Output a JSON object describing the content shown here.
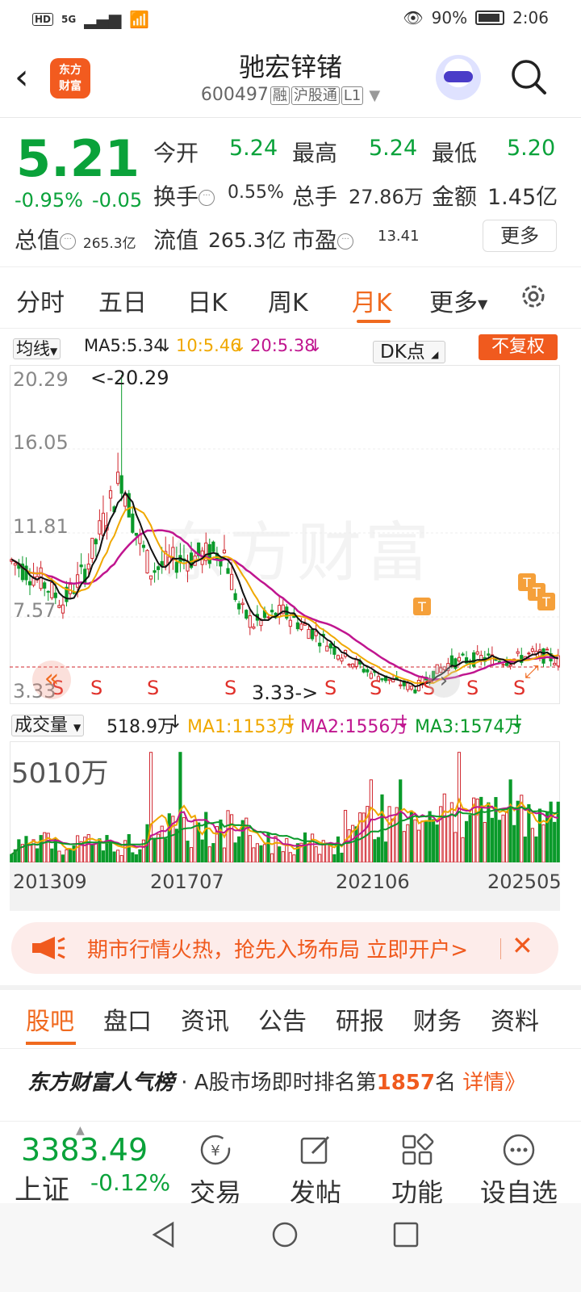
{
  "status": {
    "net": "5G",
    "hd": "HD",
    "battery_pct": "90%",
    "time": "2:06"
  },
  "header": {
    "title": "驰宏锌锗",
    "code": "600497",
    "tags": [
      "融",
      "沪股通",
      "L1"
    ],
    "logo_text_line1": "东方",
    "logo_text_line2": "财富"
  },
  "quote": {
    "price": "5.21",
    "change_pct": "-0.95%",
    "change_abs": "-0.05",
    "market_value_label": "总值",
    "market_value": "265.3亿",
    "rows": [
      [
        {
          "k": "今开",
          "v": "5.24"
        },
        {
          "k": "最高",
          "v": "5.24"
        },
        {
          "k": "最低",
          "v": "5.20"
        }
      ],
      [
        {
          "k": "换手",
          "v": "0.55%"
        },
        {
          "k": "总手",
          "v": "27.86万"
        },
        {
          "k": "金额",
          "v": "1.45亿"
        }
      ],
      [
        {
          "k": "流值",
          "v": "265.3亿"
        },
        {
          "k": "市盈",
          "v": "13.41"
        }
      ]
    ],
    "more_label": "更多"
  },
  "period_tabs": [
    "分时",
    "五日",
    "日K",
    "周K",
    "月K",
    "更多"
  ],
  "active_period": "月K",
  "indicator": {
    "ma_select": "均线",
    "ma5": "MA5:5.34",
    "ma10": "10:5.46",
    "ma20": "20:5.38",
    "dk": "DK点",
    "fuquan": "不复权"
  },
  "volume_indicator": {
    "select": "成交量",
    "value": "518.9万",
    "ma1": "MA1:1153万",
    "ma2": "MA2:1556万",
    "ma3": "MA3:1574万",
    "max_label": "5010万"
  },
  "chart_data": {
    "type": "candlestick",
    "y_ticks": [
      "20.29",
      "16.05",
      "11.81",
      "7.57",
      "3.33"
    ],
    "max_marker": "<-20.29",
    "min_marker": "3.33->",
    "x_ticks": [
      "201309",
      "201707",
      "202106",
      "202505"
    ],
    "ylim": [
      3.33,
      20.29
    ],
    "colors": {
      "up": "#d0242c",
      "down": "#0a9a2a",
      "ma5": "#111111",
      "ma10": "#f0a800",
      "ma20": "#c0158f"
    }
  },
  "banner": {
    "text": "期市行情火热，抢先入场布局 立即开户>"
  },
  "lower_tabs": [
    "股吧",
    "盘口",
    "资讯",
    "公告",
    "研报",
    "财务",
    "资料"
  ],
  "rank": {
    "brand": "东方财富人气榜",
    "text": "· A股市场即时排名第",
    "num": "1857",
    "suffix": "名",
    "detail": "详情》"
  },
  "bottom": {
    "index_value": "3383.49",
    "index_name": "上证",
    "index_change": "-0.12%",
    "items": [
      "交易",
      "发帖",
      "功能",
      "设自选"
    ]
  }
}
